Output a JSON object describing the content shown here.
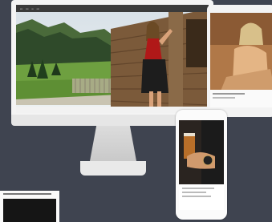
{
  "scene": {
    "background_color": "#3f4450",
    "devices": [
      "desktop-monitor",
      "tablet",
      "smartphone",
      "small-browser-window"
    ]
  },
  "desktop_site": {
    "nav_links": [
      "",
      "",
      "",
      "",
      "",
      ""
    ]
  },
  "phone_site": {
    "caption_lines": [
      "",
      "",
      ""
    ]
  }
}
